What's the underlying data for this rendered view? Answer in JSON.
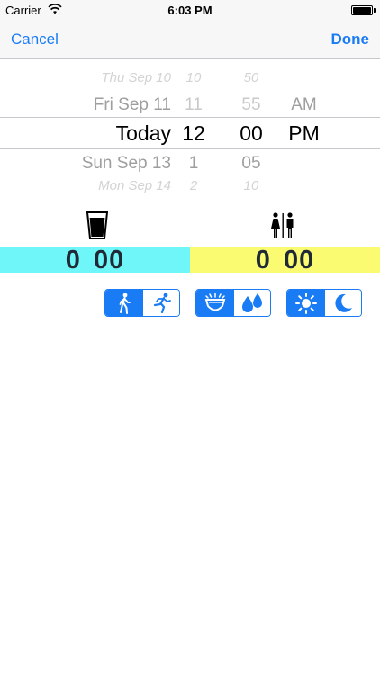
{
  "status_bar": {
    "carrier": "Carrier",
    "time": "6:03 PM"
  },
  "nav": {
    "cancel_label": "Cancel",
    "done_label": "Done"
  },
  "picker": {
    "dates": [
      "Thu Sep 10",
      "Fri Sep 11",
      "Today",
      "Sun Sep 13",
      "Mon Sep 14"
    ],
    "hours": [
      "10",
      "11",
      "12",
      "1",
      "2"
    ],
    "minutes": [
      "50",
      "55",
      "00",
      "05",
      "10"
    ],
    "ampm": [
      "",
      "AM",
      "PM",
      "",
      ""
    ],
    "selected": {
      "date": "Today",
      "hour": "12",
      "minute": "00",
      "ampm": "PM"
    }
  },
  "counters": {
    "intake": {
      "major": "0",
      "minor": "00",
      "color": "#6ff6f9"
    },
    "output": {
      "major": "0",
      "minor": "00",
      "color": "#fbfb71"
    }
  },
  "toggles": {
    "activity": {
      "options": [
        "walk-icon",
        "run-icon"
      ],
      "selected": 0
    },
    "diaper": {
      "options": [
        "diaper-icon",
        "drops-icon"
      ],
      "selected": 0
    },
    "day_night": {
      "options": [
        "sun-icon",
        "moon-icon"
      ],
      "selected": 0
    }
  },
  "colors": {
    "accent": "#1a7cf5"
  }
}
